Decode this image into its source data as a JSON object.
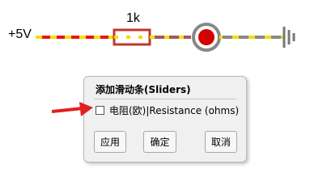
{
  "circuit": {
    "voltage_label": "+5V",
    "resistor_value": "1k",
    "colors": {
      "wire_hot": "#e8151b",
      "wire_cold": "#888888",
      "current_dots": "#f0e000",
      "resistor_box": "#c0392b",
      "led_fill": "#d40000",
      "ground": "#777777"
    }
  },
  "dialog": {
    "title": "添加滑动条(Sliders)",
    "checkbox_label": "电阻(欧)|Resistance (ohms)",
    "checkbox_checked": false,
    "buttons": {
      "apply": "应用",
      "ok": "确定",
      "cancel": "取消"
    }
  },
  "annotation": {
    "arrow_color": "#e02020"
  }
}
